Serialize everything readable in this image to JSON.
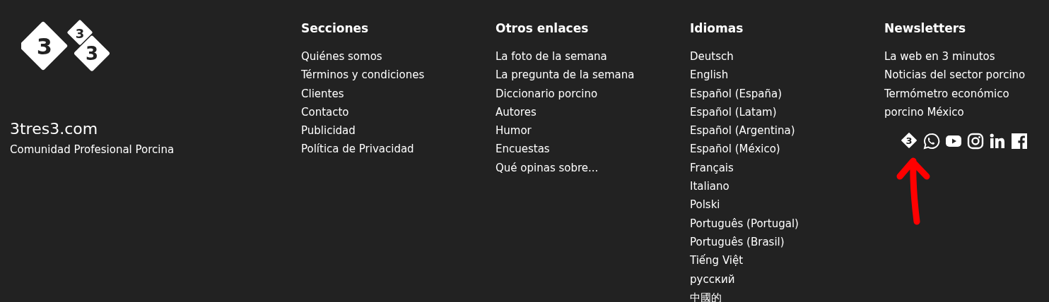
{
  "brand": {
    "logo_digits": [
      "3",
      "3",
      "3"
    ],
    "site": "3tres3.com",
    "tagline": "Comunidad Profesional Porcina"
  },
  "columns": [
    {
      "title": "Secciones",
      "links": [
        "Quiénes somos",
        "Términos y condiciones",
        "Clientes",
        "Contacto",
        "Publicidad",
        "Política de Privacidad"
      ]
    },
    {
      "title": "Otros enlaces",
      "links": [
        "La foto de la semana",
        "La pregunta de la semana",
        "Diccionario porcino",
        "Autores",
        "Humor",
        "Encuestas",
        "Qué opinas sobre..."
      ]
    },
    {
      "title": "Idiomas",
      "links": [
        "Deutsch",
        "English",
        "Español (España)",
        "Español (Latam)",
        "Español (Argentina)",
        "Español (México)",
        "Français",
        "Italiano",
        "Polski",
        "Português (Portugal)",
        "Português (Brasil)",
        "Tiếng Việt",
        "русский",
        "中國的"
      ]
    },
    {
      "title": "Newsletters",
      "links": [
        "La web en 3 minutos",
        "Noticias del sector porcino",
        "Termómetro económico porcino México"
      ]
    }
  ],
  "social": [
    {
      "kind": "brand3",
      "digit": "3"
    },
    {
      "kind": "chat"
    },
    {
      "kind": "video"
    },
    {
      "kind": "camera"
    },
    {
      "kind": "linkedin"
    },
    {
      "kind": "facebook"
    }
  ],
  "annotation": {
    "kind": "arrow"
  }
}
